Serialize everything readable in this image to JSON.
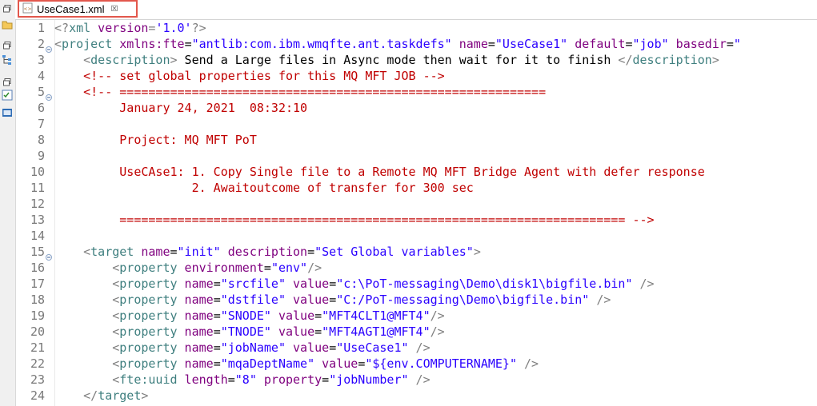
{
  "tab": {
    "title": "UseCase1.xml",
    "close_glyph": "☒",
    "file_icon": "xml-file-icon"
  },
  "side_icons": [
    "restore-icon",
    "folder-icon",
    "restore-icon",
    "hierarchy-icon",
    "restore-icon",
    "task-list-icon",
    "console-icon"
  ],
  "lines": [
    {
      "n": "1",
      "fold": false,
      "tokens": [
        {
          "k": "p",
          "t": "<?"
        },
        {
          "k": "t",
          "t": "xml"
        },
        {
          "k": "a",
          "t": " version"
        },
        {
          "k": "p",
          "t": "="
        },
        {
          "k": "v",
          "t": "'1.0'"
        },
        {
          "k": "p",
          "t": "?>"
        }
      ]
    },
    {
      "n": "2",
      "fold": true,
      "tokens": [
        {
          "k": "p",
          "t": "<"
        },
        {
          "k": "t",
          "t": "project"
        },
        {
          "k": "a",
          "t": " xmlns:fte"
        },
        {
          "k": "k",
          "t": "="
        },
        {
          "k": "v",
          "t": "\"antlib:com.ibm.wmqfte.ant.taskdefs\""
        },
        {
          "k": "a",
          "t": " name"
        },
        {
          "k": "k",
          "t": "="
        },
        {
          "k": "v",
          "t": "\"UseCase1\""
        },
        {
          "k": "a",
          "t": " default"
        },
        {
          "k": "k",
          "t": "="
        },
        {
          "k": "v",
          "t": "\"job\""
        },
        {
          "k": "a",
          "t": " basedir"
        },
        {
          "k": "k",
          "t": "="
        },
        {
          "k": "v",
          "t": "\""
        }
      ]
    },
    {
      "n": "3",
      "fold": false,
      "tokens": [
        {
          "k": "k",
          "t": "    "
        },
        {
          "k": "p",
          "t": "<"
        },
        {
          "k": "t",
          "t": "description"
        },
        {
          "k": "p",
          "t": ">"
        },
        {
          "k": "k",
          "t": " Send a Large files in Async mode then wait for it to finish "
        },
        {
          "k": "p",
          "t": "</"
        },
        {
          "k": "t",
          "t": "description"
        },
        {
          "k": "p",
          "t": ">"
        }
      ]
    },
    {
      "n": "4",
      "fold": false,
      "tokens": [
        {
          "k": "k",
          "t": "    "
        },
        {
          "k": "cmt",
          "t": "<!-- set global properties for this MQ MFT JOB -->"
        }
      ]
    },
    {
      "n": "5",
      "fold": true,
      "tokens": [
        {
          "k": "k",
          "t": "    "
        },
        {
          "k": "cmt",
          "t": "<!-- ==========================================================="
        }
      ]
    },
    {
      "n": "6",
      "fold": false,
      "tokens": [
        {
          "k": "cmt",
          "t": "         January 24, 2021  08:32:10"
        }
      ]
    },
    {
      "n": "7",
      "fold": false,
      "tokens": []
    },
    {
      "n": "8",
      "fold": false,
      "tokens": [
        {
          "k": "cmt",
          "t": "         Project: MQ MFT PoT"
        }
      ]
    },
    {
      "n": "9",
      "fold": false,
      "tokens": []
    },
    {
      "n": "10",
      "fold": false,
      "tokens": [
        {
          "k": "cmt",
          "t": "         UseCAse1: 1. Copy Single file to a Remote MQ MFT Bridge Agent with defer response"
        }
      ]
    },
    {
      "n": "11",
      "fold": false,
      "tokens": [
        {
          "k": "cmt",
          "t": "                   2. Awaitoutcome of transfer for 300 sec"
        }
      ]
    },
    {
      "n": "12",
      "fold": false,
      "tokens": []
    },
    {
      "n": "13",
      "fold": false,
      "tokens": [
        {
          "k": "cmt",
          "t": "         ====================================================================== -->"
        }
      ]
    },
    {
      "n": "14",
      "fold": false,
      "tokens": []
    },
    {
      "n": "15",
      "fold": true,
      "tokens": [
        {
          "k": "k",
          "t": "    "
        },
        {
          "k": "p",
          "t": "<"
        },
        {
          "k": "t",
          "t": "target"
        },
        {
          "k": "a",
          "t": " name"
        },
        {
          "k": "k",
          "t": "="
        },
        {
          "k": "v",
          "t": "\"init\""
        },
        {
          "k": "a",
          "t": " description"
        },
        {
          "k": "k",
          "t": "="
        },
        {
          "k": "v",
          "t": "\"Set Global variables\""
        },
        {
          "k": "p",
          "t": ">"
        }
      ]
    },
    {
      "n": "16",
      "fold": false,
      "tokens": [
        {
          "k": "k",
          "t": "        "
        },
        {
          "k": "p",
          "t": "<"
        },
        {
          "k": "t",
          "t": "property"
        },
        {
          "k": "a",
          "t": " environment"
        },
        {
          "k": "k",
          "t": "="
        },
        {
          "k": "v",
          "t": "\"env\""
        },
        {
          "k": "p",
          "t": "/>"
        }
      ]
    },
    {
      "n": "17",
      "fold": false,
      "tokens": [
        {
          "k": "k",
          "t": "        "
        },
        {
          "k": "p",
          "t": "<"
        },
        {
          "k": "t",
          "t": "property"
        },
        {
          "k": "a",
          "t": " name"
        },
        {
          "k": "k",
          "t": "="
        },
        {
          "k": "v",
          "t": "\"srcfile\""
        },
        {
          "k": "a",
          "t": " value"
        },
        {
          "k": "k",
          "t": "="
        },
        {
          "k": "v",
          "t": "\"c:\\PoT-messaging\\Demo\\disk1\\bigfile.bin\""
        },
        {
          "k": "p",
          "t": " />"
        }
      ]
    },
    {
      "n": "18",
      "fold": false,
      "tokens": [
        {
          "k": "k",
          "t": "        "
        },
        {
          "k": "p",
          "t": "<"
        },
        {
          "k": "t",
          "t": "property"
        },
        {
          "k": "a",
          "t": " name"
        },
        {
          "k": "k",
          "t": "="
        },
        {
          "k": "v",
          "t": "\"dstfile\""
        },
        {
          "k": "a",
          "t": " value"
        },
        {
          "k": "k",
          "t": "="
        },
        {
          "k": "v",
          "t": "\"C:/PoT-messaging\\Demo\\bigfile.bin\""
        },
        {
          "k": "p",
          "t": " />"
        }
      ]
    },
    {
      "n": "19",
      "fold": false,
      "tokens": [
        {
          "k": "k",
          "t": "        "
        },
        {
          "k": "p",
          "t": "<"
        },
        {
          "k": "t",
          "t": "property"
        },
        {
          "k": "a",
          "t": " name"
        },
        {
          "k": "k",
          "t": "="
        },
        {
          "k": "v",
          "t": "\"SNODE\""
        },
        {
          "k": "a",
          "t": " value"
        },
        {
          "k": "k",
          "t": "="
        },
        {
          "k": "v",
          "t": "\"MFT4CLT1@MFT4\""
        },
        {
          "k": "p",
          "t": "/>"
        }
      ]
    },
    {
      "n": "20",
      "fold": false,
      "tokens": [
        {
          "k": "k",
          "t": "        "
        },
        {
          "k": "p",
          "t": "<"
        },
        {
          "k": "t",
          "t": "property"
        },
        {
          "k": "a",
          "t": " name"
        },
        {
          "k": "k",
          "t": "="
        },
        {
          "k": "v",
          "t": "\"TNODE\""
        },
        {
          "k": "a",
          "t": " value"
        },
        {
          "k": "k",
          "t": "="
        },
        {
          "k": "v",
          "t": "\"MFT4AGT1@MFT4\""
        },
        {
          "k": "p",
          "t": "/>"
        }
      ]
    },
    {
      "n": "21",
      "fold": false,
      "tokens": [
        {
          "k": "k",
          "t": "        "
        },
        {
          "k": "p",
          "t": "<"
        },
        {
          "k": "t",
          "t": "property"
        },
        {
          "k": "a",
          "t": " name"
        },
        {
          "k": "k",
          "t": "="
        },
        {
          "k": "v",
          "t": "\"jobName\""
        },
        {
          "k": "a",
          "t": " value"
        },
        {
          "k": "k",
          "t": "="
        },
        {
          "k": "v",
          "t": "\"UseCase1\""
        },
        {
          "k": "p",
          "t": " />"
        }
      ]
    },
    {
      "n": "22",
      "fold": false,
      "tokens": [
        {
          "k": "k",
          "t": "        "
        },
        {
          "k": "p",
          "t": "<"
        },
        {
          "k": "t",
          "t": "property"
        },
        {
          "k": "a",
          "t": " name"
        },
        {
          "k": "k",
          "t": "="
        },
        {
          "k": "v",
          "t": "\"mqaDeptName\""
        },
        {
          "k": "a",
          "t": " value"
        },
        {
          "k": "k",
          "t": "="
        },
        {
          "k": "v",
          "t": "\"${env.COMPUTERNAME}\""
        },
        {
          "k": "p",
          "t": " />"
        }
      ]
    },
    {
      "n": "23",
      "fold": false,
      "tokens": [
        {
          "k": "k",
          "t": "        "
        },
        {
          "k": "p",
          "t": "<"
        },
        {
          "k": "t",
          "t": "fte:uuid"
        },
        {
          "k": "a",
          "t": " length"
        },
        {
          "k": "k",
          "t": "="
        },
        {
          "k": "v",
          "t": "\"8\""
        },
        {
          "k": "a",
          "t": " property"
        },
        {
          "k": "k",
          "t": "="
        },
        {
          "k": "v",
          "t": "\"jobNumber\""
        },
        {
          "k": "p",
          "t": " />"
        }
      ]
    },
    {
      "n": "24",
      "fold": false,
      "tokens": [
        {
          "k": "k",
          "t": "    "
        },
        {
          "k": "p",
          "t": "</"
        },
        {
          "k": "t",
          "t": "target"
        },
        {
          "k": "p",
          "t": ">"
        }
      ]
    }
  ]
}
